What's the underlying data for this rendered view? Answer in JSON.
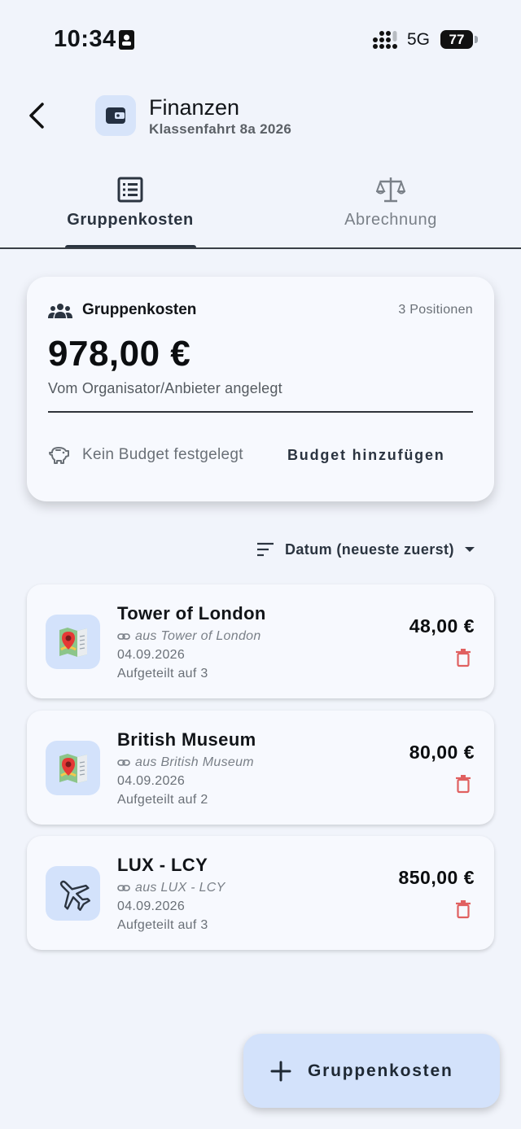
{
  "status_bar": {
    "time": "10:34",
    "network": "5G",
    "battery": "77"
  },
  "header": {
    "title": "Finanzen",
    "subtitle": "Klassenfahrt 8a 2026"
  },
  "tabs": [
    {
      "label": "Gruppenkosten",
      "icon": "list-icon",
      "active": true
    },
    {
      "label": "Abrechnung",
      "icon": "scale-icon",
      "active": false
    }
  ],
  "summary": {
    "title": "Gruppenkosten",
    "count": "3 Positionen",
    "amount": "978,00 €",
    "note": "Vom Organisator/Anbieter angelegt",
    "budget_text": "Kein Budget festgelegt",
    "budget_action": "Budget hinzufügen"
  },
  "sort": {
    "label": "Datum (neueste zuerst)"
  },
  "expenses": [
    {
      "name": "Tower of London",
      "source": "aus Tower of London",
      "date": "04.09.2026",
      "split": "Aufgeteilt auf 3",
      "amount": "48,00 €",
      "icon": "map-icon"
    },
    {
      "name": "British Museum",
      "source": "aus British Museum",
      "date": "04.09.2026",
      "split": "Aufgeteilt auf 2",
      "amount": "80,00 €",
      "icon": "map-icon"
    },
    {
      "name": "LUX - LCY",
      "source": "aus LUX - LCY",
      "date": "04.09.2026",
      "split": "Aufgeteilt auf 3",
      "amount": "850,00 €",
      "icon": "airplane-icon"
    }
  ],
  "fab": {
    "label": "Gruppenkosten"
  },
  "colors": {
    "background": "#f1f4fb",
    "card": "#f7f9fe",
    "accent_light": "#d3e2fb",
    "text_primary": "#111418",
    "delete": "#e06060"
  }
}
